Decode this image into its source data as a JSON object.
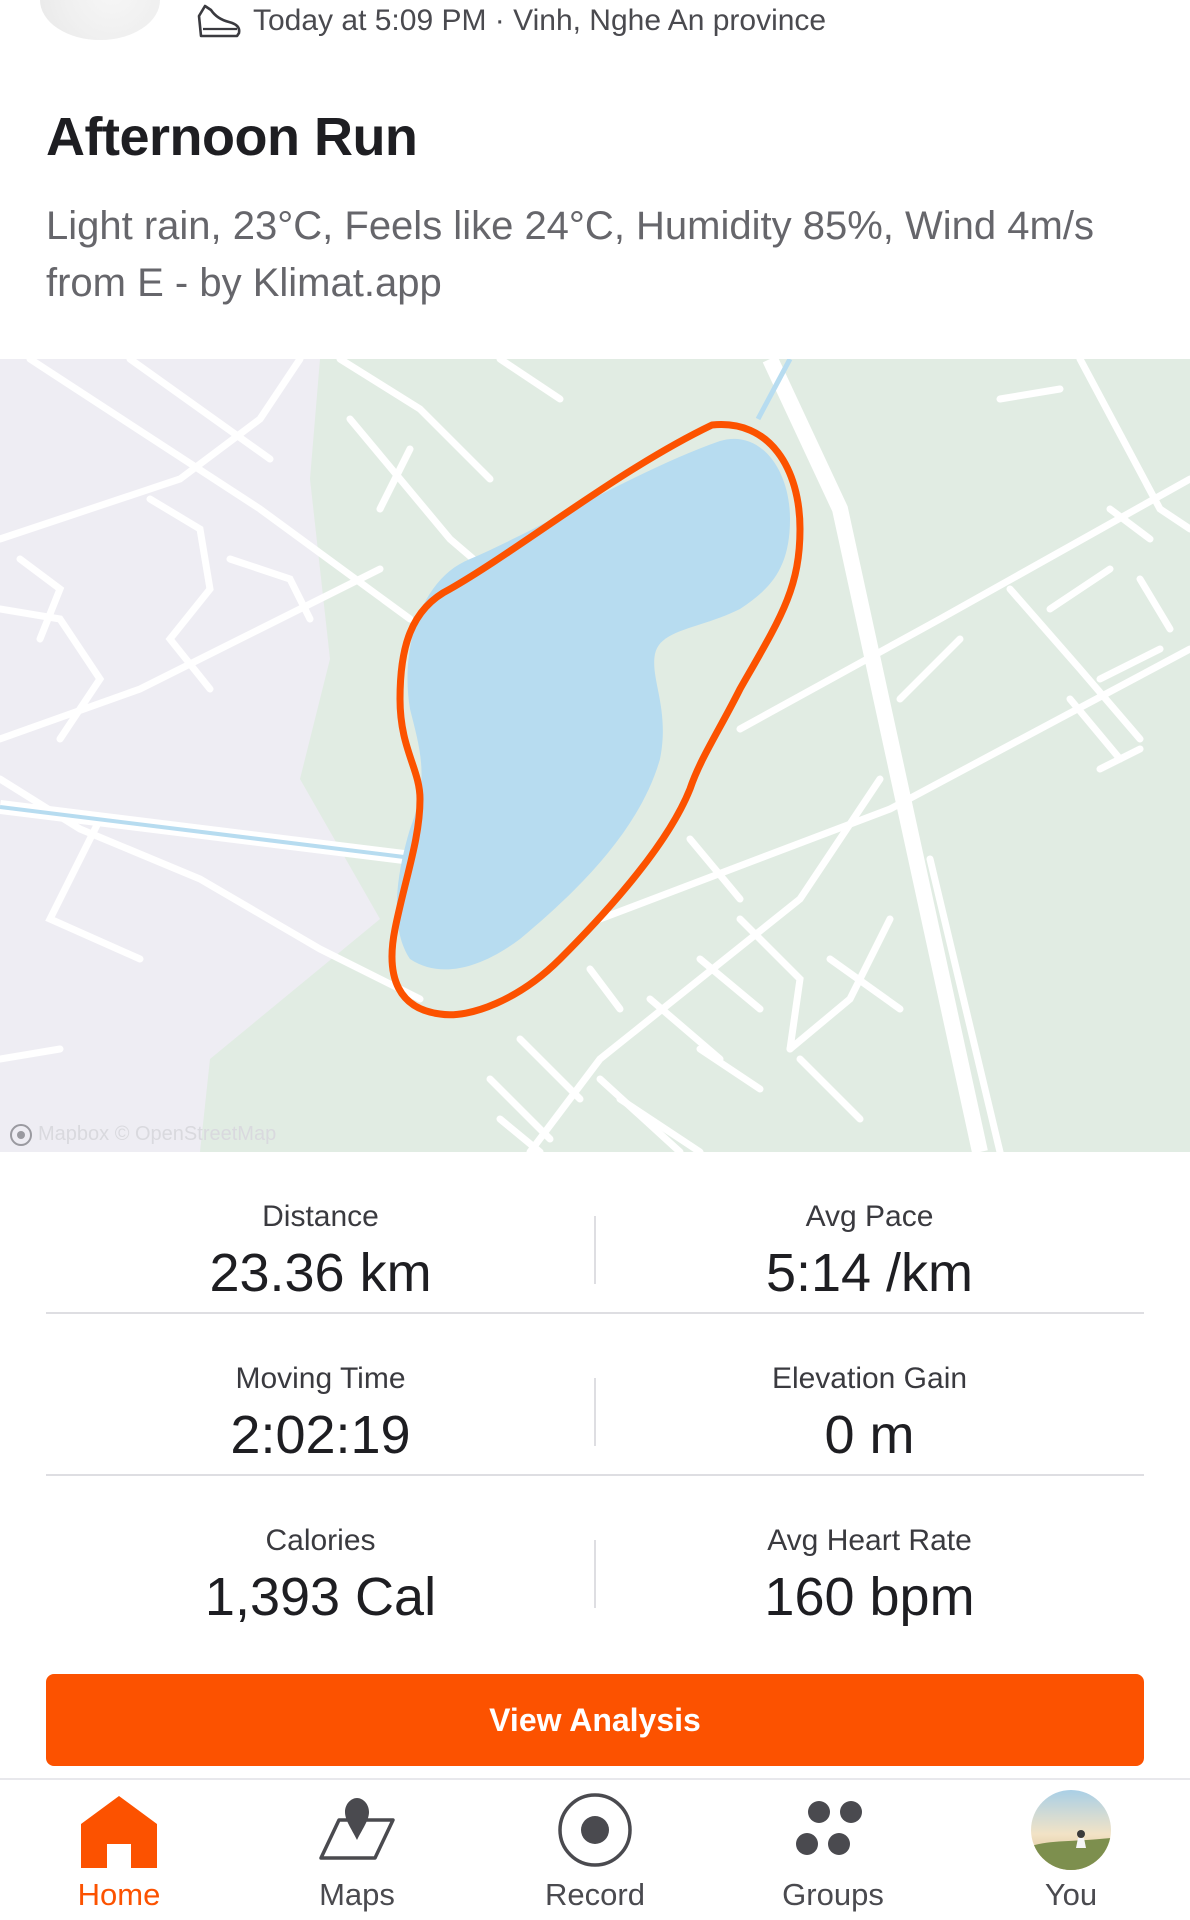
{
  "activity": {
    "meta": "Today at 5:09 PM · Vinh, Nghe An province",
    "title": "Afternoon Run",
    "description": "Light rain, 23°C, Feels like 24°C, Humidity 85%, Wind 4m/s from E - by Klimat.app"
  },
  "map": {
    "attribution": "Mapbox © OpenStreetMap",
    "route_color": "#fc5200",
    "water_color": "#b7dcf0",
    "park_color": "#e1ece3"
  },
  "stats": [
    {
      "label": "Distance",
      "value": "23.36 km"
    },
    {
      "label": "Avg Pace",
      "value": "5:14 /km"
    },
    {
      "label": "Moving Time",
      "value": "2:02:19"
    },
    {
      "label": "Elevation Gain",
      "value": "0 m"
    },
    {
      "label": "Calories",
      "value": "1,393 Cal"
    },
    {
      "label": "Avg Heart Rate",
      "value": "160 bpm"
    }
  ],
  "actions": {
    "view_analysis": "View Analysis"
  },
  "tabbar": {
    "active": "Home",
    "items": [
      {
        "label": "Home",
        "icon": "home-icon"
      },
      {
        "label": "Maps",
        "icon": "map-pin-icon"
      },
      {
        "label": "Record",
        "icon": "record-icon"
      },
      {
        "label": "Groups",
        "icon": "groups-icon"
      },
      {
        "label": "You",
        "icon": "profile-avatar"
      }
    ]
  },
  "colors": {
    "brand": "#fc5200",
    "text_primary": "#1e1e22",
    "text_secondary": "#66666b"
  }
}
